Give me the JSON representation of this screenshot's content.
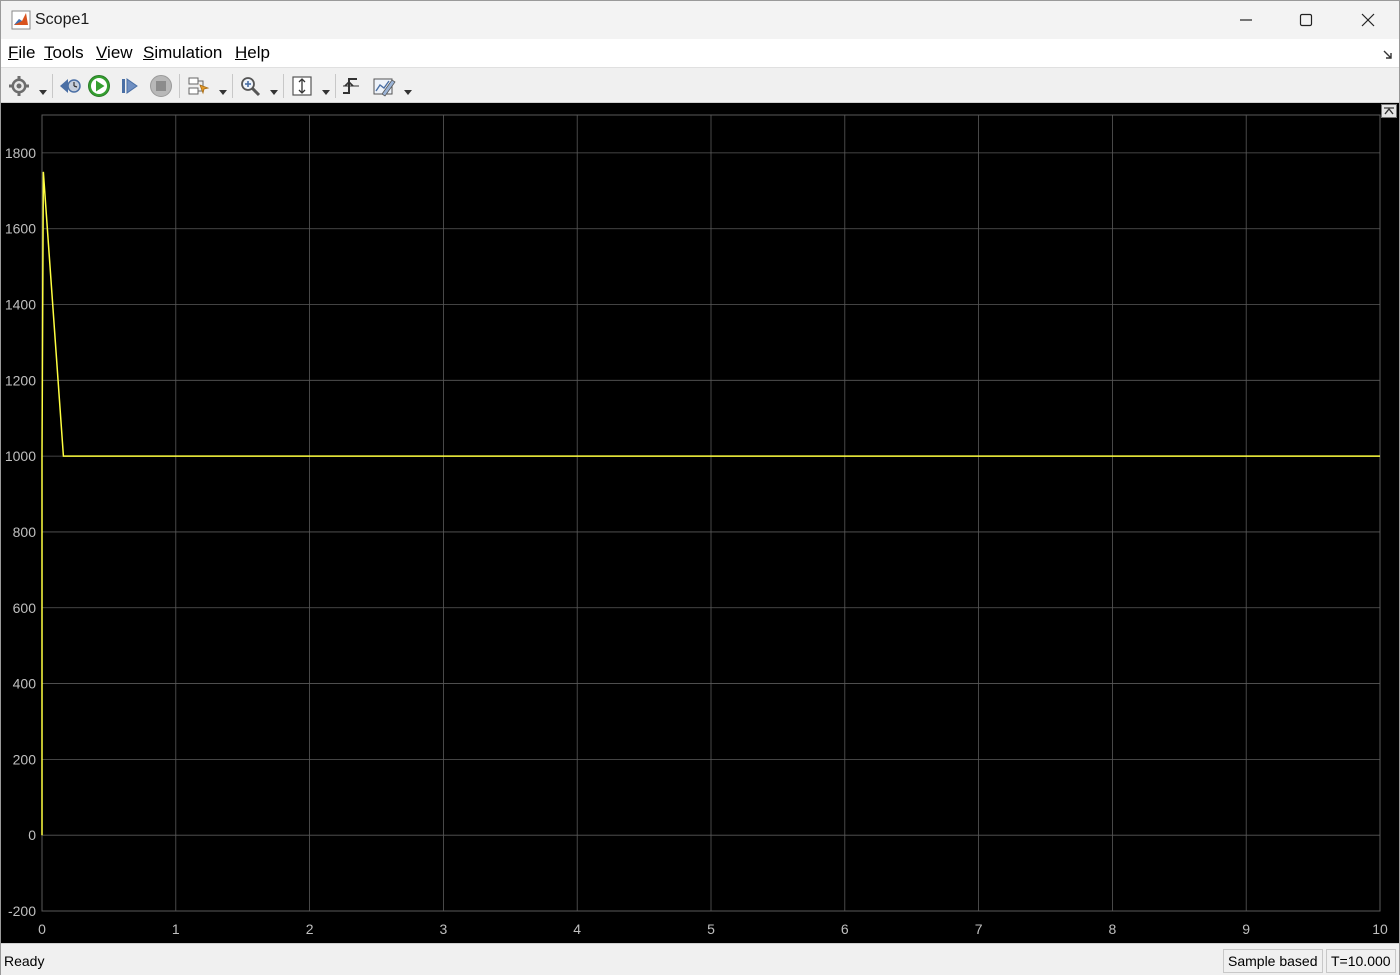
{
  "window": {
    "title": "Scope1",
    "icon": "matlab-icon",
    "controls": [
      "minimize-icon",
      "maximize-icon",
      "close-icon"
    ]
  },
  "menu": {
    "items": [
      {
        "label": "File",
        "underline": "F",
        "rest": "ile"
      },
      {
        "label": "Tools",
        "underline": "T",
        "rest": "ools"
      },
      {
        "label": "View",
        "underline": "V",
        "rest": "iew"
      },
      {
        "label": "Simulation",
        "underline": "S",
        "rest": "imulation"
      },
      {
        "label": "Help",
        "underline": "H",
        "rest": "elp"
      }
    ]
  },
  "toolbar": {
    "buttons": [
      "settings-icon",
      "step-back-icon",
      "run-icon",
      "step-forward-icon",
      "stop-icon",
      "highlight-block-icon",
      "zoom-icon",
      "scale-axes-icon",
      "triggers-icon",
      "measurements-icon"
    ]
  },
  "status": {
    "text": "Ready",
    "mode": "Sample based",
    "time": "T=10.000"
  },
  "colors": {
    "plot_background": "#000000",
    "grid": "#5a5a5a",
    "axis_text": "#bfbfbf",
    "signal": "#ffff40"
  },
  "chart_data": {
    "type": "line",
    "title": "",
    "xlabel": "",
    "ylabel": "",
    "xlim": [
      0,
      10
    ],
    "ylim": [
      -200,
      1900
    ],
    "x_ticks": [
      "0",
      "1",
      "2",
      "3",
      "4",
      "5",
      "6",
      "7",
      "8",
      "9",
      "10"
    ],
    "y_ticks": [
      "-200",
      "0",
      "200",
      "400",
      "600",
      "800",
      "1000",
      "1200",
      "1400",
      "1600",
      "1800"
    ],
    "grid": true,
    "series": [
      {
        "x": [
          0,
          0,
          0.01,
          0.16,
          10
        ],
        "y": [
          0,
          1000,
          1750,
          1000,
          1000
        ]
      }
    ]
  }
}
